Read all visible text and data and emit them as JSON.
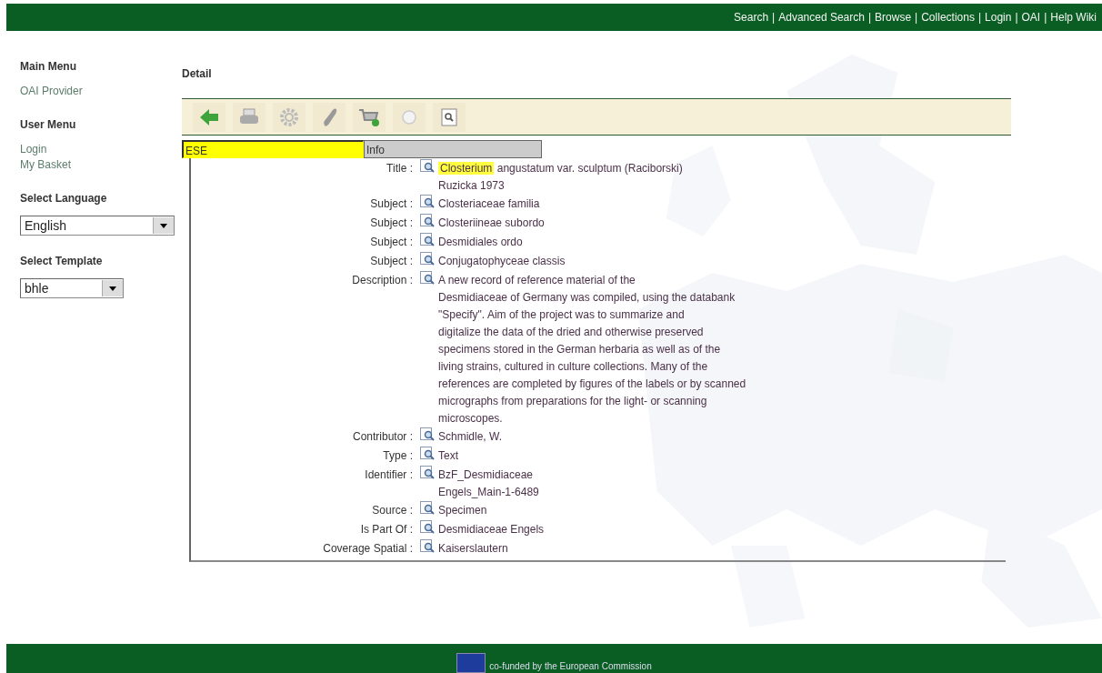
{
  "top_nav": {
    "links": [
      "Search",
      "Advanced Search",
      "Browse",
      "Collections",
      "Login",
      "OAI",
      "Help Wiki"
    ],
    "separator": "|"
  },
  "sidebar": {
    "sections": [
      {
        "kind": "menu",
        "heading": "Main Menu",
        "items": [
          "OAI Provider"
        ]
      },
      {
        "kind": "menu",
        "heading": "User Menu",
        "items": [
          "Login",
          "My Basket"
        ]
      },
      {
        "kind": "select",
        "heading": "Select Language",
        "value": "English"
      },
      {
        "kind": "select",
        "heading": "Select Template",
        "value": "bhle"
      }
    ]
  },
  "page_title": "Detail",
  "toolbar": [
    {
      "kind": "back"
    },
    {
      "kind": "print"
    },
    {
      "kind": "settings"
    },
    {
      "kind": "attach"
    },
    {
      "kind": "basket"
    },
    {
      "kind": "circle"
    },
    {
      "kind": "zoom"
    }
  ],
  "tabs": [
    {
      "label": "ESE",
      "selected": true
    },
    {
      "label": "Info",
      "selected": false
    }
  ],
  "record": [
    {
      "label": "Title :",
      "highlight": "Closterium",
      "lines": [
        "angustatum var. sculptum (Raciborski)",
        "Ruzicka 1973"
      ]
    },
    {
      "label": "Subject :",
      "lines": [
        "Closteriaceae familia"
      ]
    },
    {
      "label": "Subject :",
      "lines": [
        "Closteriineae subordo"
      ]
    },
    {
      "label": "Subject :",
      "lines": [
        "Desmidiales ordo"
      ]
    },
    {
      "label": "Subject :",
      "lines": [
        "Conjugatophyceae classis"
      ]
    },
    {
      "label": "Description :",
      "lines": [
        "A new record of reference material of the",
        "Desmidiaceae of Germany was compiled, using the databank",
        "\"Specify\". Aim of the project was to summarize and",
        "digitalize the data of the dried and otherwise preserved",
        "specimens stored in the German herbaria as well as of the",
        "living strains, cultured in culture collections. Many of the",
        "references are completed by figures of the labels or by scanned",
        "micrographs from preparations for the light- or scanning",
        "microscopes."
      ]
    },
    {
      "label": "Contributor :",
      "lines": [
        "Schmidle, W."
      ]
    },
    {
      "label": "Type :",
      "lines": [
        "Text"
      ]
    },
    {
      "label": "Identifier :",
      "lines": [
        "BzF_Desmidiaceae",
        "Engels_Main-1-6489"
      ]
    },
    {
      "label": "Source :",
      "lines": [
        "Specimen"
      ]
    },
    {
      "label": "Is Part Of :",
      "lines": [
        "Desmidiaceae Engels"
      ]
    },
    {
      "label": "Coverage Spatial :",
      "lines": [
        "Kaiserslautern"
      ]
    }
  ],
  "footer": {
    "text": "co-funded by the European Commission"
  }
}
